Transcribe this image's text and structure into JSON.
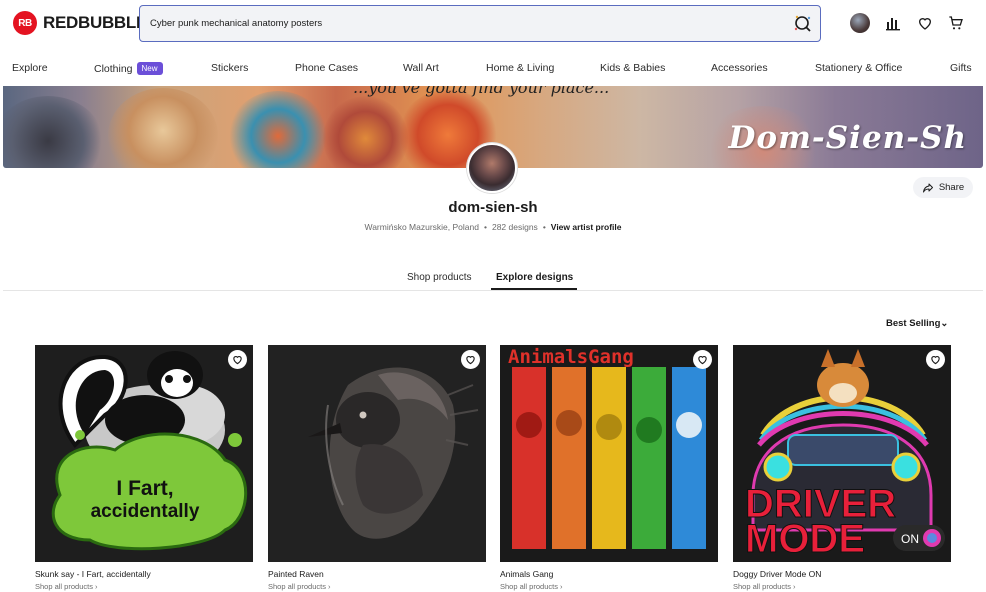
{
  "header": {
    "logo_text": "REDBUBBLE",
    "logo_badge": "RB",
    "search_value": "Cyber punk mechanical anatomy posters"
  },
  "nav": {
    "items": [
      "Explore",
      "Clothing",
      "Stickers",
      "Phone Cases",
      "Wall Art",
      "Home & Living",
      "Kids & Babies",
      "Accessories",
      "Stationery & Office",
      "Gifts"
    ],
    "new_badge": "New"
  },
  "banner": {
    "script_text": "...you've gotta find your place...",
    "signature": "Dom-Sien-Sh"
  },
  "profile": {
    "name": "dom-sien-sh",
    "location": "Warmińsko Mazurskie, Poland",
    "designs": "282 designs",
    "view_profile": "View artist profile",
    "share": "Share"
  },
  "tabs": {
    "shop": "Shop products",
    "explore": "Explore designs"
  },
  "sort_label": "Best Selling",
  "cards": [
    {
      "title": "Skunk say - I Fart, accidentally",
      "link": "Shop all products ›",
      "art_text_1": "I Fart,",
      "art_text_2": "accidentally"
    },
    {
      "title": "Painted Raven",
      "link": "Shop all products ›"
    },
    {
      "title": "Animals Gang",
      "link": "Shop all products ›",
      "art_text_1": "AnimalsGang"
    },
    {
      "title": "Doggy Driver Mode ON",
      "link": "Shop all products ›",
      "art_text_1": "DRIVER",
      "art_text_2": "MODE",
      "art_text_3": "ON"
    }
  ],
  "colors": {
    "brand_red": "#e41321",
    "new_badge": "#6b4fd8",
    "search_border": "#5a6cbf"
  }
}
